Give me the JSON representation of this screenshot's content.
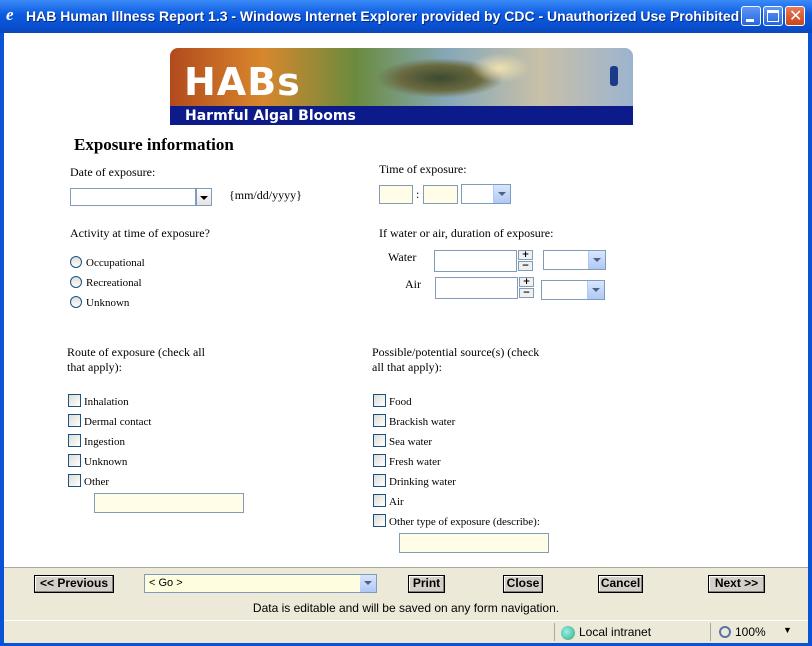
{
  "window": {
    "title": "HAB Human Illness Report 1.3 - Windows Internet Explorer provided by CDC - Unauthorized Use Prohibited",
    "icon": "ie-icon",
    "controls": [
      "minimize-icon",
      "maximize-icon",
      "close-icon"
    ]
  },
  "banner": {
    "logo": "HABs",
    "subtitle": "Harmful Algal Blooms"
  },
  "form": {
    "heading": "Exposure information",
    "date": {
      "label": "Date of exposure:",
      "value": "",
      "hint": "{mm/dd/yyyy}"
    },
    "time": {
      "label": "Time of exposure:",
      "hour": "",
      "minute": "",
      "separator": ":",
      "ampm": ""
    },
    "activity": {
      "label": "Activity at time of exposure?",
      "options": [
        "Occupational",
        "Recreational",
        "Unknown"
      ]
    },
    "duration": {
      "label": "If water or air, duration of exposure:",
      "water_label": "Water",
      "air_label": "Air",
      "water_value": "",
      "air_value": "",
      "water_unit": "",
      "air_unit": "",
      "plus": "+",
      "minus": "−"
    },
    "route": {
      "label_line1": "Route of exposure (check all",
      "label_line2": "that apply):",
      "options": [
        "Inhalation",
        "Dermal contact",
        "Ingestion",
        "Unknown",
        "Other"
      ],
      "other_value": ""
    },
    "source": {
      "label_line1": "Possible/potential source(s) (check",
      "label_line2": "all that apply):",
      "options": [
        "Food",
        "Brackish water",
        "Sea water",
        "Fresh water",
        "Drinking water",
        "Air",
        "Other type of exposure (describe):"
      ],
      "other_value": ""
    }
  },
  "nav": {
    "previous": "<< Previous",
    "go": "< Go >",
    "print": "Print",
    "close": "Close",
    "cancel": "Cancel",
    "next": "Next >>",
    "note": "Data is editable and will be saved on any form navigation."
  },
  "status": {
    "zone": "Local intranet",
    "zoom": "100%"
  },
  "colors": {
    "title_bar": "#0a5ae0",
    "banner_strip": "#0c1a8a",
    "field_yellow": "#fffde8"
  }
}
